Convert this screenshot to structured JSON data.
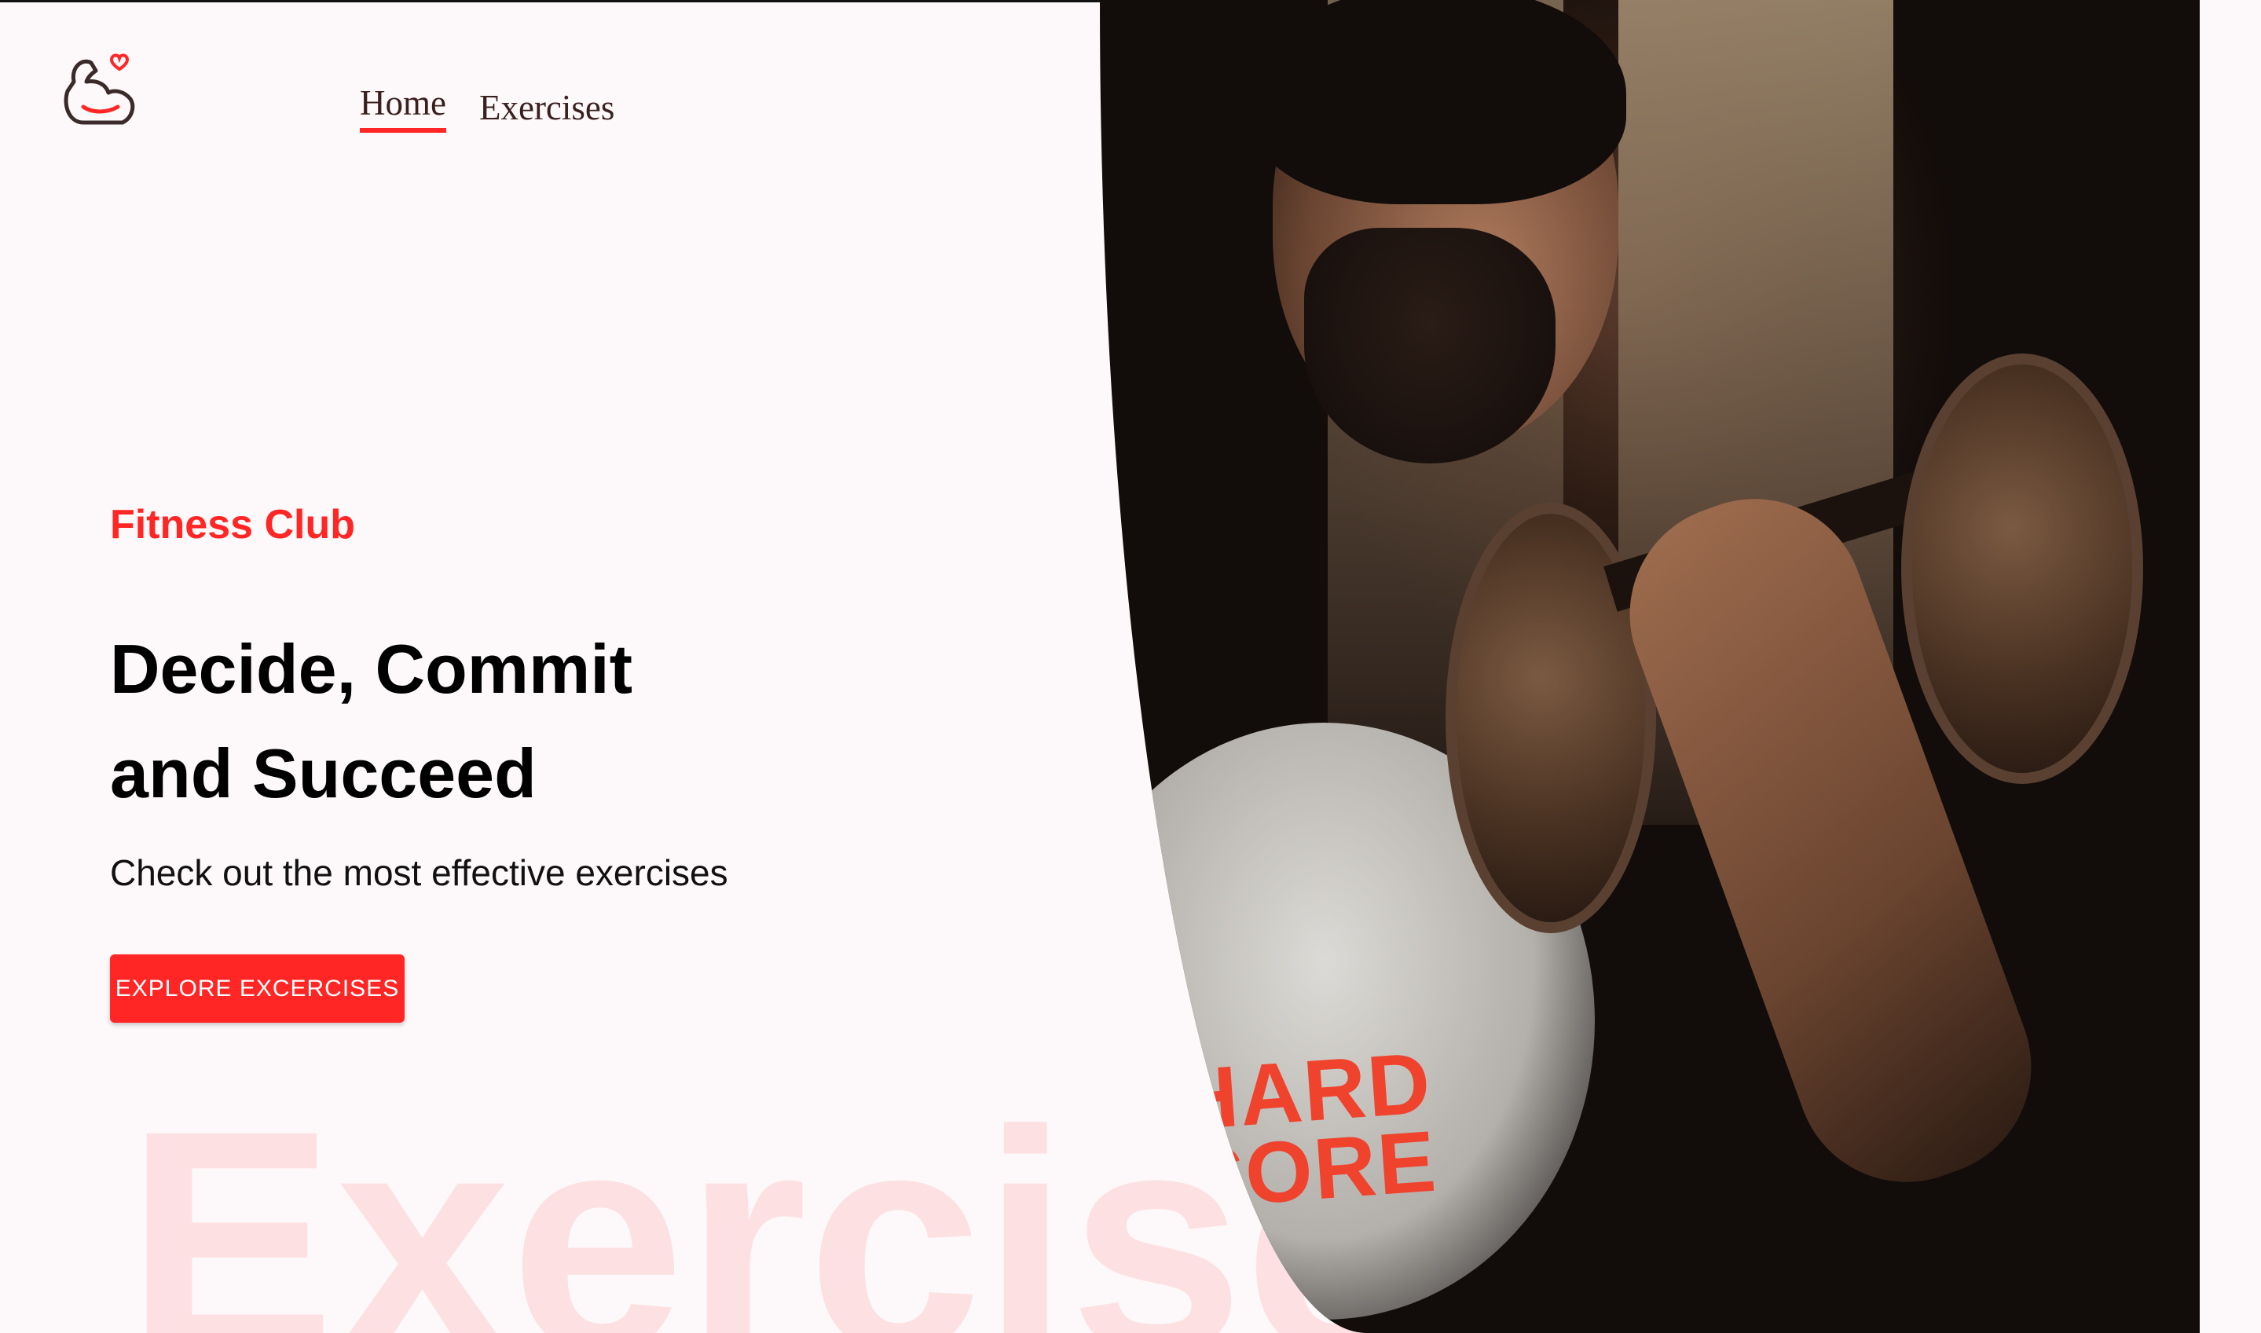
{
  "brand": {
    "logo_icon": "flexed-arm-heart-icon"
  },
  "nav": {
    "items": [
      {
        "label": "Home",
        "active": true
      },
      {
        "label": "Exercises",
        "active": false
      }
    ]
  },
  "hero": {
    "eyebrow": "Fitness Club",
    "headline_line1": "Decide, Commit",
    "headline_line2": "and Succeed",
    "subline": "Check out the most effective exercises",
    "cta_label": "EXPLORE EXCERCISES",
    "watermark": "Exercises",
    "image_text": "HARD CORE"
  },
  "colors": {
    "accent": "#ff2625",
    "background": "#fdf8f9",
    "text": "#000000"
  }
}
